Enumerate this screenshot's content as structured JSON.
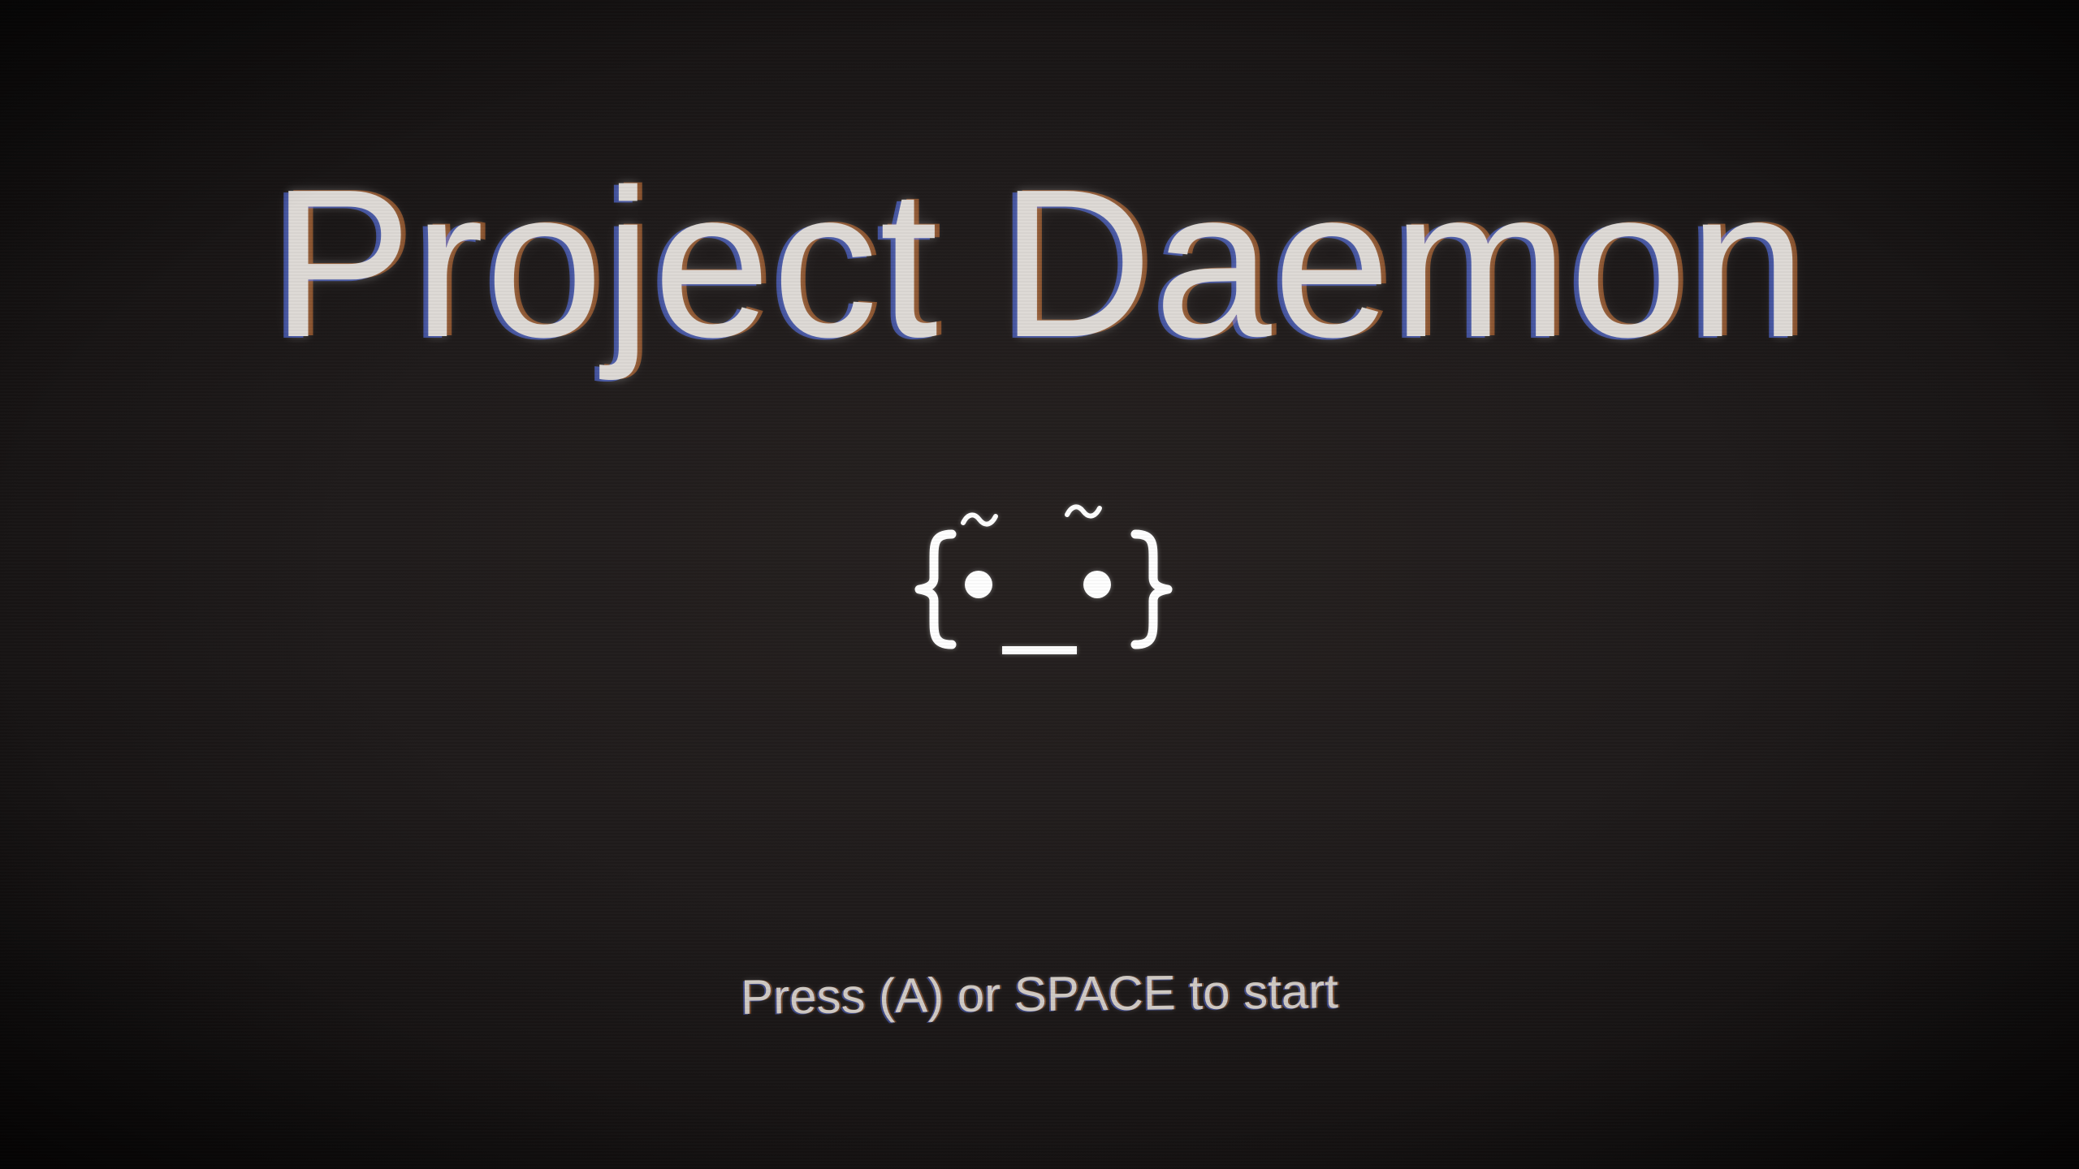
{
  "screen": {
    "title": "Project Daemon",
    "prompt": "Press (A) or SPACE to start"
  },
  "mascot": {
    "icon": "daemon-face-icon"
  },
  "colors": {
    "background": "#1c1818",
    "title": "#dedad6",
    "prompt": "#cfcac4",
    "mascot": "#ffffff"
  }
}
